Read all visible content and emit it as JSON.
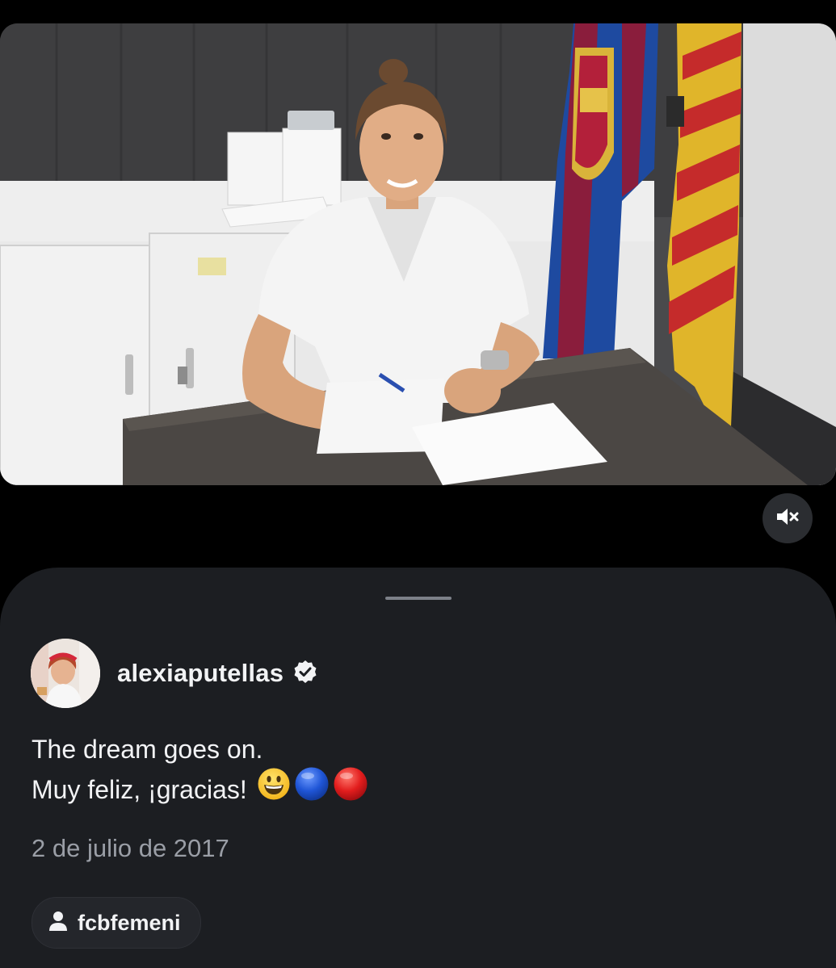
{
  "post": {
    "username": "alexiaputellas",
    "verified": true,
    "caption_line1": "The dream goes on.",
    "caption_line2": "Muy feliz, ¡gracias!",
    "caption_emojis": [
      "grinning-face",
      "blue-circle",
      "red-circle"
    ],
    "date": "2 de julio de 2017",
    "tagged_user": "fcbfemeni"
  },
  "media": {
    "type": "photo",
    "muted": true,
    "icons": {
      "mute": "speaker-muted-icon"
    }
  },
  "colors": {
    "background": "#000000",
    "sheet": "#1c1e22",
    "text_primary": "#f2f3f5",
    "text_secondary": "#9a9ea6",
    "chip": "#24262b"
  }
}
